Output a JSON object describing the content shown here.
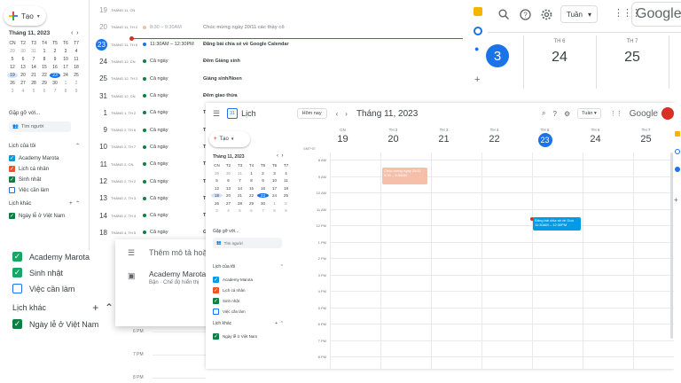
{
  "colors": {
    "accent": "#1a73e8",
    "green": "#0b8043",
    "orange": "#e8710a",
    "peach": "#f6bfaa",
    "red_line": "#d93025",
    "checkbox_teal": "#16a765",
    "checkbox_red": "#d81b60"
  },
  "bg_left": {
    "create_label": "Tạo",
    "mini_title": "Tháng 11, 2023",
    "weekday_headers": [
      "CN",
      "T2",
      "T3",
      "T4",
      "T5",
      "T6",
      "T7"
    ],
    "days": [
      "29",
      "30",
      "31",
      "1",
      "2",
      "3",
      "4",
      "5",
      "6",
      "7",
      "8",
      "9",
      "10",
      "11",
      "12",
      "13",
      "14",
      "15",
      "16",
      "17",
      "18",
      "19",
      "20",
      "21",
      "22",
      "23",
      "24",
      "25",
      "26",
      "27",
      "28",
      "29",
      "30",
      "1",
      "2",
      "3",
      "4",
      "5",
      "6",
      "7",
      "8",
      "9"
    ],
    "meet_title": "Gặp gỡ với...",
    "search_people": "Tìm người",
    "my_cals_title": "Lịch của tôi",
    "my_cals": [
      "Academy Marota",
      "Lịch cá nhân",
      "Sinh nhật",
      "Việc cần làm"
    ],
    "other_cals_title": "Lịch khác",
    "other_cals": [
      "Ngày lễ ở Việt Nam"
    ]
  },
  "schedule": {
    "rows": [
      {
        "num": "19",
        "date": "THÁNG 11, CN",
        "time": "",
        "title": "",
        "faded": true
      },
      {
        "num": "20",
        "date": "THÁNG 11, TH 2",
        "time": "8:30 – 9:30AM",
        "title": "Chúc mừng ngày 20/11 các thầy cô",
        "faded": true
      },
      {
        "num": "23",
        "date": "THÁNG 11, TH 5",
        "time": "11:30AM – 12:30PM",
        "title": "Đăng bài chia sẻ về Google Calendar",
        "faded": false,
        "today": true
      },
      {
        "num": "24",
        "date": "THÁNG 12, CN",
        "time": "Cả ngày",
        "title": "Đêm Giáng sinh",
        "faded": false
      },
      {
        "num": "25",
        "date": "THÁNG 12, TH 2",
        "time": "Cả ngày",
        "title": "Giáng sinh/Noen",
        "faded": false
      },
      {
        "num": "31",
        "date": "THÁNG 12, CN",
        "time": "Cả ngày",
        "title": "Đêm giao thừa",
        "faded": false
      },
      {
        "num": "1",
        "date": "THÁNG 1, TH 2",
        "time": "Cả ngày",
        "title": "T",
        "faded": false
      },
      {
        "num": "9",
        "date": "THÁNG 2, TH 6",
        "time": "Cả ngày",
        "title": "T",
        "faded": false
      },
      {
        "num": "10",
        "date": "THÁNG 2, TH 7",
        "time": "Cả ngày",
        "title": "T",
        "faded": false
      },
      {
        "num": "11",
        "date": "THÁNG 2, CN",
        "time": "Cả ngày",
        "title": "T",
        "faded": false
      },
      {
        "num": "12",
        "date": "THÁNG 2, TH 2",
        "time": "Cả ngày",
        "title": "T",
        "faded": false
      },
      {
        "num": "13",
        "date": "THÁNG 2, TH 3",
        "time": "Cả ngày",
        "title": "T",
        "faded": false
      },
      {
        "num": "14",
        "date": "THÁNG 2, TH 4",
        "time": "Cả ngày",
        "title": "T",
        "faded": false
      },
      {
        "num": "18",
        "date": "THÁNG 4, TH 5",
        "time": "Cả ngày",
        "title": "G",
        "faded": false
      }
    ]
  },
  "bg_week": {
    "view_label": "Tuần",
    "google": "Google",
    "days": [
      {
        "label": "",
        "num": "3",
        "today": true
      },
      {
        "label": "TH 6",
        "num": "24"
      },
      {
        "label": "TH 7",
        "num": "25"
      }
    ]
  },
  "popover": {
    "line1": "Thêm mô tả hoặc",
    "line2": "Academy Marota",
    "line3": "Bận · Chế độ hiển thị"
  },
  "bg_lower": {
    "items": [
      "Academy Marota",
      "Sinh nhật",
      "Việc cần làm"
    ],
    "other_title": "Lịch khác",
    "other_item": "Ngày lễ ở Việt Nam",
    "times": [
      "6 PM",
      "7 PM",
      "8 PM"
    ]
  },
  "main": {
    "app_name": "Lịch",
    "today_btn": "Hôm nay",
    "month_title": "Tháng 11, 2023",
    "view_label": "Tuần",
    "google": "Google",
    "create_label": "Tạo",
    "mini_title": "Tháng 11, 2023",
    "weekday_headers": [
      "CN",
      "T2",
      "T3",
      "T4",
      "T5",
      "T6",
      "T7"
    ],
    "days": [
      "29",
      "30",
      "31",
      "1",
      "2",
      "3",
      "4",
      "5",
      "6",
      "7",
      "8",
      "9",
      "10",
      "11",
      "12",
      "13",
      "14",
      "15",
      "16",
      "17",
      "18",
      "19",
      "20",
      "21",
      "22",
      "23",
      "24",
      "25",
      "26",
      "27",
      "28",
      "29",
      "30",
      "1",
      "2",
      "3",
      "4",
      "5",
      "6",
      "7",
      "8",
      "9"
    ],
    "meet_title": "Gặp gỡ với...",
    "search_people": "Tìm người",
    "my_cals_title": "Lịch của tôi",
    "my_cals": [
      "Academy Marota",
      "Lịch cá nhân",
      "Sinh nhật",
      "Việc cần làm"
    ],
    "other_cals_title": "Lịch khác",
    "other_cals": [
      "Ngày lễ ở Việt Nam"
    ],
    "timezone": "GMT+07",
    "week_days": [
      {
        "label": "CN",
        "num": "19"
      },
      {
        "label": "TH 2",
        "num": "20"
      },
      {
        "label": "TH 3",
        "num": "21"
      },
      {
        "label": "TH 4",
        "num": "22"
      },
      {
        "label": "TH 5",
        "num": "23",
        "today": true
      },
      {
        "label": "TH 6",
        "num": "24"
      },
      {
        "label": "TH 7",
        "num": "25"
      }
    ],
    "hours": [
      "8 AM",
      "9 AM",
      "10 AM",
      "11 AM",
      "12 PM",
      "1 PM",
      "2 PM",
      "3 PM",
      "4 PM",
      "5 PM",
      "6 PM",
      "7 PM",
      "8 PM"
    ],
    "events": [
      {
        "title": "Chúc mừng ngày 20/11",
        "time": "8:30 – 9:30AM"
      },
      {
        "title": "Đăng bài chia sẻ về Goo",
        "time": "11:30AM – 12:30PM"
      }
    ]
  }
}
